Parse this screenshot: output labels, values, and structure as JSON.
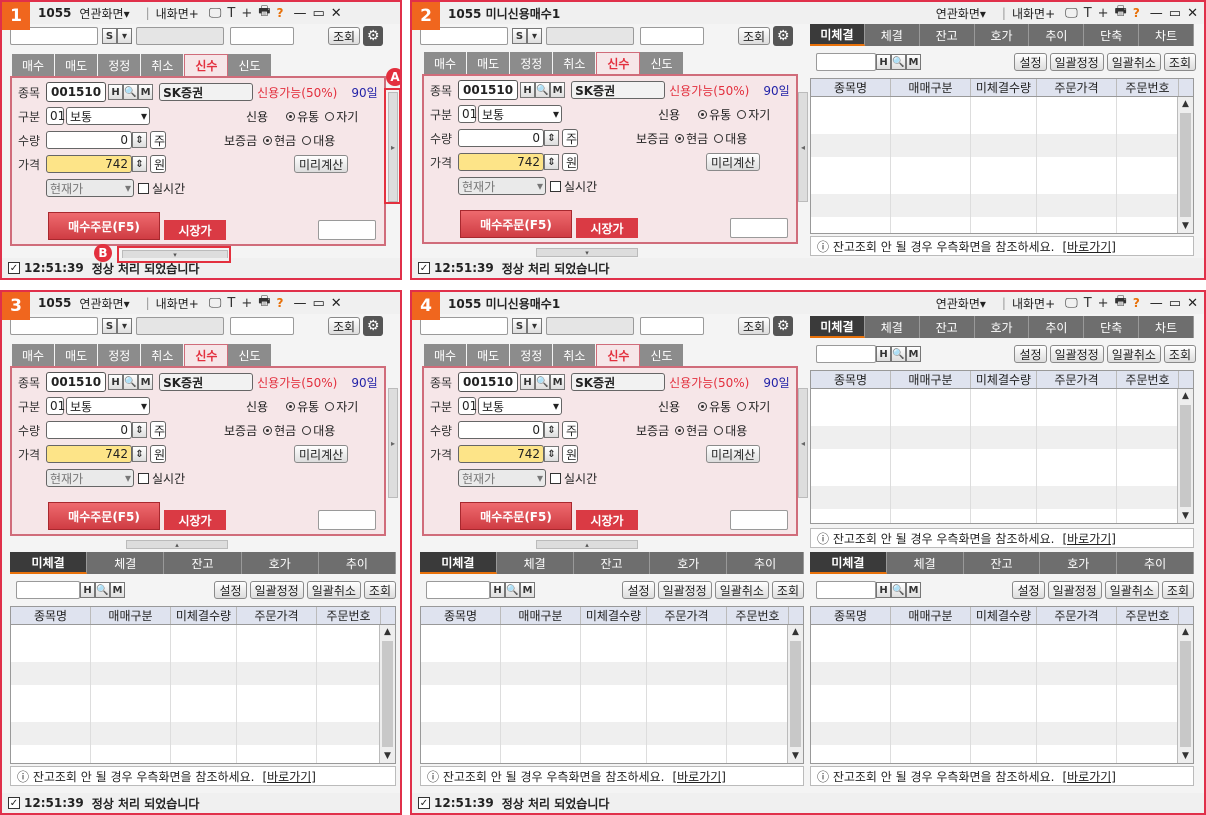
{
  "panels": [
    {
      "num": "1",
      "title": "1055",
      "menu_related": "연관화면▾",
      "menu_mine": "내화면+"
    },
    {
      "num": "2",
      "title": "1055 미니신용매수1",
      "menu_related": "연관화면▾",
      "menu_mine": "내화면+"
    },
    {
      "num": "3",
      "title": "1055",
      "menu_related": "연관화면▾",
      "menu_mine": "내화면+"
    },
    {
      "num": "4",
      "title": "1055 미니신용매수1",
      "menu_related": "연관화면▾",
      "menu_mine": "내화면+"
    }
  ],
  "toolbar": {
    "s_label": "S",
    "search_btn": "조회",
    "help": "?",
    "icons": [
      "monitor-icon",
      "text-icon",
      "plus-icon",
      "print-icon"
    ],
    "win_min": "—",
    "win_max": "▭",
    "win_close": "✕"
  },
  "order_tabs": [
    "매수",
    "매도",
    "정정",
    "취소",
    "신수",
    "신도"
  ],
  "active_order_tab": "신수",
  "form": {
    "label_item": "종목",
    "code": "001510",
    "code_btns": [
      "H",
      "Q",
      "M"
    ],
    "name": "SK증권",
    "credit_avail": "신용가능(50%)",
    "days": "90일",
    "label_type": "구분",
    "type_num": "01",
    "type_val": "보통",
    "label_credit": "신용",
    "opt_yu": "유통",
    "opt_ja": "자기",
    "label_qty": "수량",
    "qty": "0",
    "unit_qty": "주",
    "label_margin": "보증금",
    "opt_cash": "현금",
    "opt_sub": "대용",
    "label_price": "가격",
    "price": "742",
    "unit_price": "원",
    "precalc": "미리계산",
    "price_type": "현재가",
    "realtime": "실시간",
    "buy_btn": "매수주문(F5)",
    "market_btn": "시장가"
  },
  "status": {
    "check": "✓",
    "time": "12:51:39",
    "message": "정상 처리 되었습니다"
  },
  "market_tabs_full": [
    "미체결",
    "체결",
    "잔고",
    "호가",
    "추이",
    "단축",
    "차트"
  ],
  "market_tabs_short": [
    "미체결",
    "체결",
    "잔고",
    "호가",
    "추이"
  ],
  "grid_tool": {
    "btns": [
      "H",
      "Q",
      "M"
    ],
    "setting": "설정",
    "batch_edit": "일괄정정",
    "batch_cancel": "일괄취소",
    "query": "조회"
  },
  "grid_cols": [
    "종목명",
    "매매구분",
    "미체결수량",
    "주문가격",
    "주문번호"
  ],
  "note": {
    "text": "ⓘ 잔고조회 안 될 경우 우측화면을 참조하세요.",
    "link": "[바로가기]"
  },
  "callouts": {
    "a": "A",
    "b": "B"
  }
}
